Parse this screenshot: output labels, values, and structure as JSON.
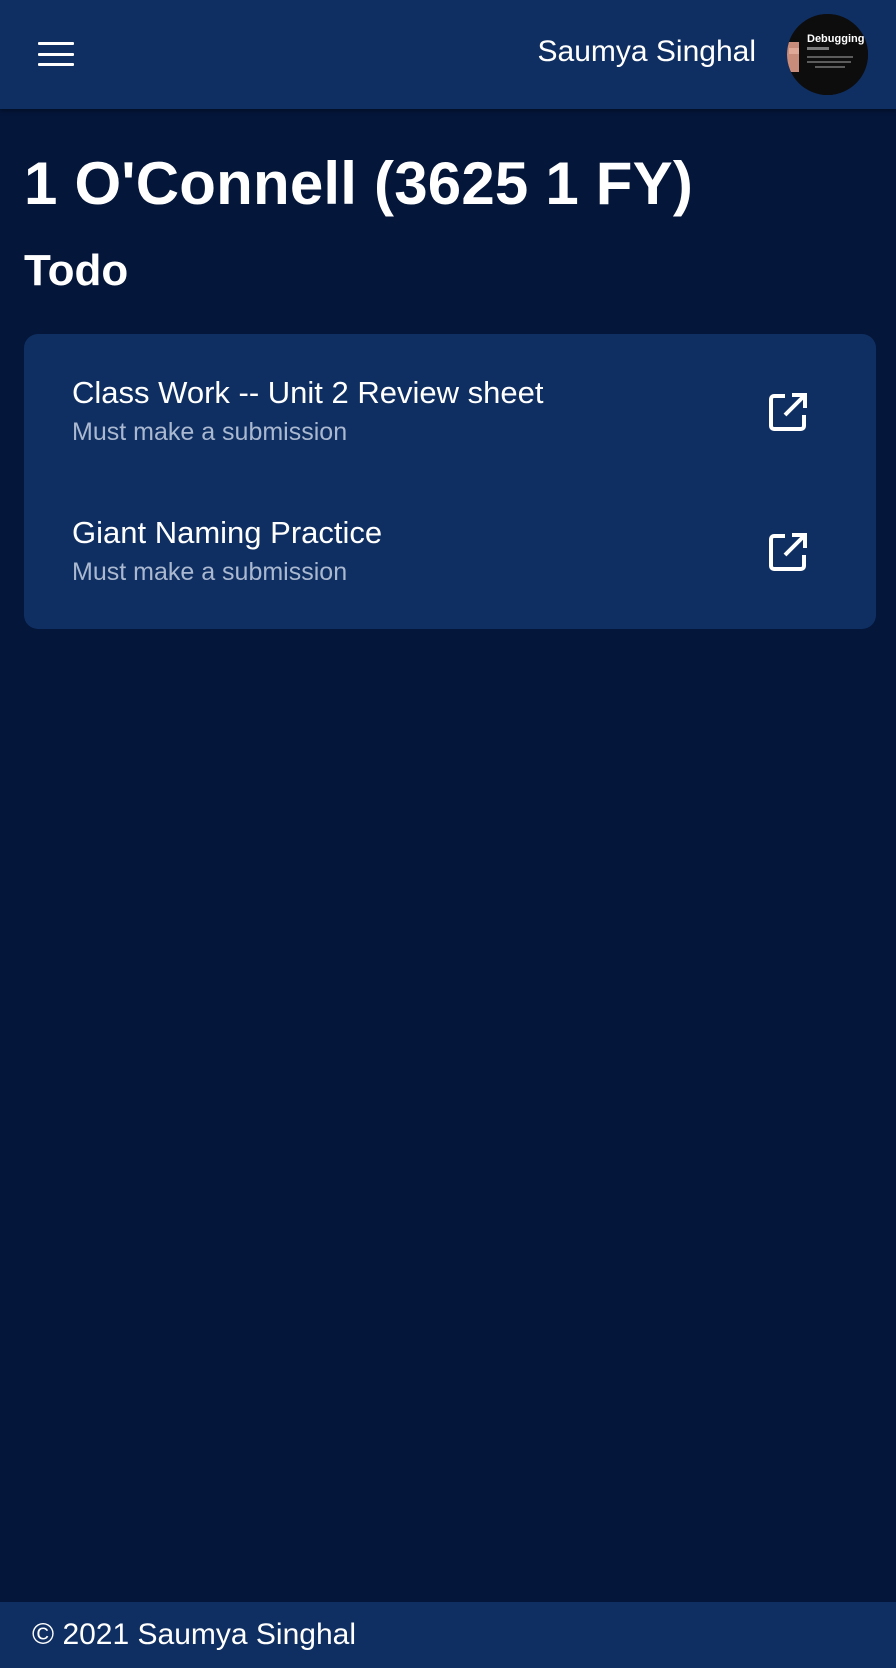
{
  "header": {
    "menu_icon": "hamburger-menu-icon",
    "user_name": "Saumya Singhal",
    "avatar_text": "Debugging"
  },
  "page": {
    "course_title": "1 O'Connell (3625 1 FY)",
    "section_title": "Todo"
  },
  "todo": {
    "items": [
      {
        "title": "Class Work -- Unit 2 Review sheet",
        "subtitle": "Must make a submission",
        "icon": "open-in-new-icon"
      },
      {
        "title": "Giant Naming Practice",
        "subtitle": "Must make a submission",
        "icon": "open-in-new-icon"
      }
    ]
  },
  "footer": {
    "copyright": "© 2021 Saumya Singhal"
  },
  "colors": {
    "background": "#04163a",
    "surface": "#0f2f62",
    "text_primary": "#ffffff",
    "text_secondary": "#aab8d0"
  }
}
